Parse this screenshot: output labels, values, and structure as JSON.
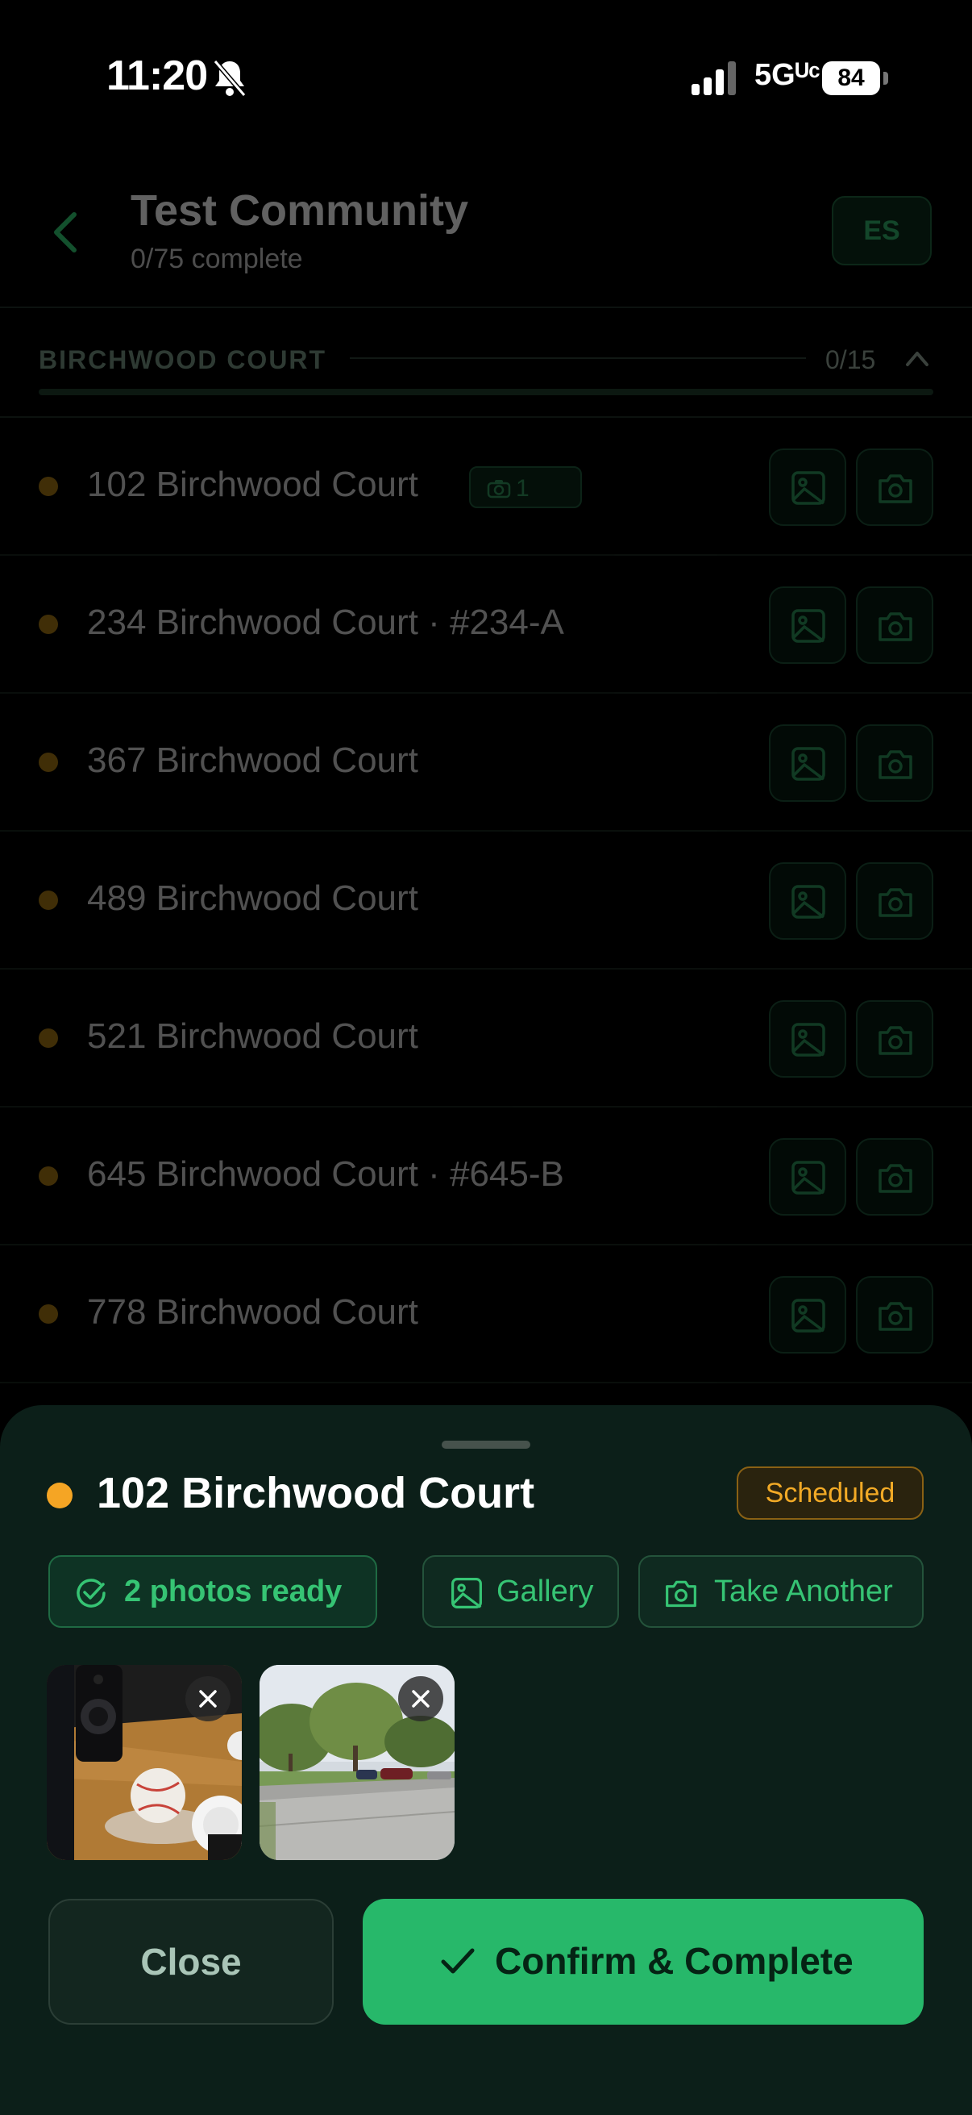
{
  "status_bar": {
    "time": "11:20",
    "network": "5Gᵁᶜ",
    "battery": "84"
  },
  "header": {
    "title": "Test Community",
    "subtitle": "0/75 complete",
    "language_button": "ES"
  },
  "section": {
    "name": "BIRCHWOOD COURT",
    "count": "0/15"
  },
  "rows": [
    {
      "address": "102 Birchwood Court",
      "photo_count": "1"
    },
    {
      "address": "234 Birchwood Court · #234-A"
    },
    {
      "address": "367 Birchwood Court"
    },
    {
      "address": "489 Birchwood Court"
    },
    {
      "address": "521 Birchwood Court"
    },
    {
      "address": "645 Birchwood Court · #645-B"
    },
    {
      "address": "778 Birchwood Court"
    }
  ],
  "sheet": {
    "address": "102 Birchwood Court",
    "status": "Scheduled",
    "photos_ready": "2 photos ready",
    "gallery_label": "Gallery",
    "take_another_label": "Take Another",
    "close_label": "Close",
    "confirm_label": "Confirm & Complete"
  },
  "colors": {
    "accent_green": "#27b86a",
    "status_orange": "#f5a524",
    "sheet_background": "#0c1f19"
  }
}
